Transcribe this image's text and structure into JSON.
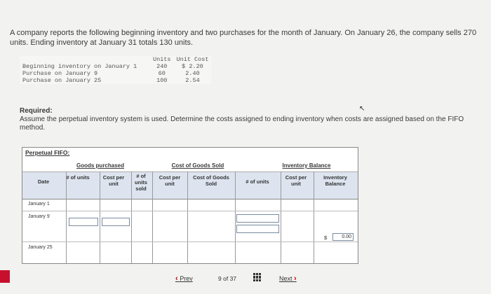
{
  "question": "A company reports the following beginning inventory and two purchases for the month of January. On January 26, the company sells 270 units. Ending inventory at January 31 totals 130 units.",
  "inventory_table": {
    "headers": [
      "Units",
      "Unit Cost"
    ],
    "rows": [
      {
        "label": "Beginning inventory on January 1",
        "units": "240",
        "cost": "$ 2.20"
      },
      {
        "label": "Purchase on January 9",
        "units": "60",
        "cost": "2.40"
      },
      {
        "label": "Purchase on January 25",
        "units": "100",
        "cost": "2.54"
      }
    ]
  },
  "required": {
    "title": "Required:",
    "text": "Assume the perpetual inventory system is used. Determine the costs assigned to ending inventory when costs are assigned based on the FIFO method."
  },
  "worksheet": {
    "title": "Perpetual FIFO:",
    "groups": {
      "purchased": "Goods purchased",
      "cogs": "Cost of Goods Sold",
      "balance": "Inventory Balance"
    },
    "columns": {
      "date": "Date",
      "p_units": "# of units",
      "p_cost": "Cost per unit",
      "c_units": "# of units sold",
      "c_cost": "Cost per unit",
      "c_total": "Cost of Goods Sold",
      "b_units": "# of units",
      "b_cost": "Cost per unit",
      "b_total": "Inventory Balance"
    },
    "rows": [
      "January 1",
      "January 9",
      "January 25"
    ],
    "balance_currency": "$",
    "balance_value": "0.00"
  },
  "footer": {
    "prev": "Prev",
    "current_page": "9",
    "of_label": "of",
    "total_pages": "37",
    "next": "Next"
  }
}
